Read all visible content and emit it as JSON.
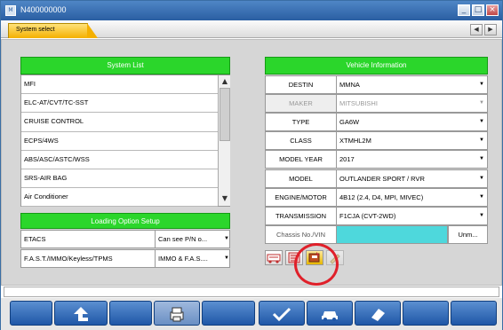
{
  "window": {
    "title": "N400000000",
    "icon": "app-icon",
    "minimize": "_",
    "maximize": "□",
    "close": "×"
  },
  "tab": {
    "label": "System select"
  },
  "nav": {
    "prev": "◀",
    "next": "▶"
  },
  "system_list": {
    "header": "System List",
    "items": [
      "MFI",
      "ELC-AT/CVT/TC-SST",
      "CRUISE CONTROL",
      "ECPS/4WS",
      "ABS/ASC/ASTC/WSS",
      "SRS-AIR BAG",
      "Air Conditioner"
    ]
  },
  "loading_option": {
    "header": "Loading Option Setup",
    "rows": [
      {
        "name": "ETACS",
        "value": "Can see P/N o..."
      },
      {
        "name": "F.A.S.T./IMMO/Keyless/TPMS",
        "value": "IMMO & F.A.S...."
      }
    ]
  },
  "vehicle_info": {
    "header": "Vehicle Information",
    "rows": [
      {
        "label": "DESTIN",
        "value": "MMNA",
        "dropdown": true
      },
      {
        "label": "MAKER",
        "value": "MITSUBISHI",
        "dropdown": true
      },
      {
        "label": "TYPE",
        "value": "GA6W",
        "dropdown": true
      },
      {
        "label": "CLASS",
        "value": "XTMHL2M",
        "dropdown": true
      },
      {
        "label": "MODEL YEAR",
        "value": "2017",
        "dropdown": true
      },
      {
        "label": "MODEL",
        "value": "OUTLANDER SPORT / RVR",
        "dropdown": true
      },
      {
        "label": "ENGINE/MOTOR",
        "value": "4B12 (2.4, D4, MPI, MIVEC)",
        "dropdown": true
      },
      {
        "label": "TRANSMISSION",
        "value": "F1CJA (CVT-2WD)",
        "dropdown": true
      }
    ],
    "chassis_label": "Chassis No./VIN",
    "chassis_value": "",
    "chassis_unit": "Unm..."
  },
  "colors": {
    "green_header": "#2bd62b",
    "blue_toolbar": "#2a5ea2",
    "tab_yellow": "#f4b000",
    "highlight_circle": "#e0202a"
  }
}
